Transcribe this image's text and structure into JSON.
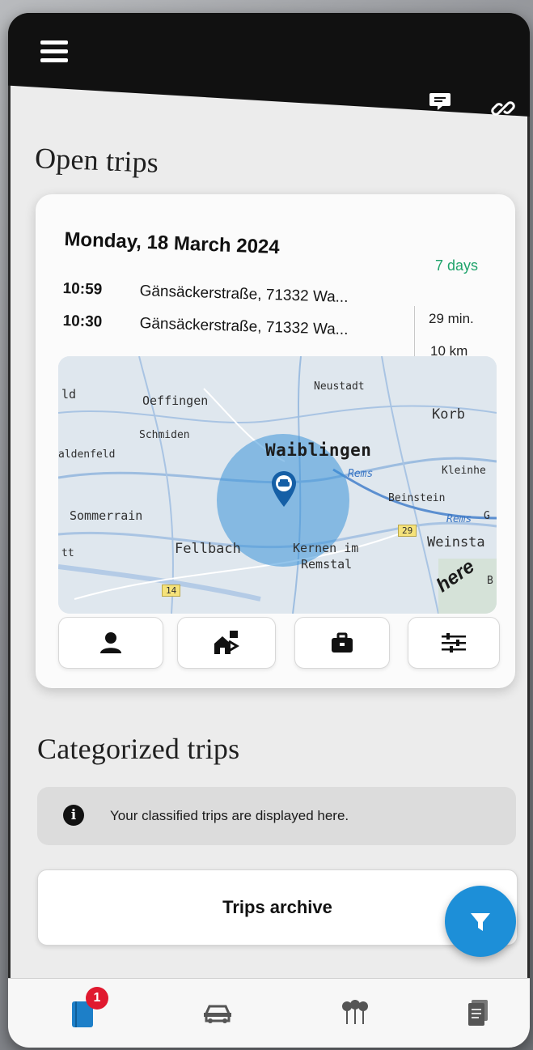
{
  "header": {
    "menu_icon": "hamburger-menu-icon",
    "actions": [
      "chat-icon",
      "link-icon"
    ]
  },
  "open_trips": {
    "title": "Open trips",
    "card": {
      "date": "Monday, 18 March 2024",
      "days_left": "7 days",
      "trips": [
        {
          "time": "10:59",
          "address": "Gänsäckerstraße, 71332 Wa..."
        },
        {
          "time": "10:30",
          "address": "Gänsäckerstraße, 71332 Wa..."
        }
      ],
      "duration": "29 min.",
      "distance": "10 km",
      "map": {
        "labels": {
          "ld": "ld",
          "oeffingen": "Oeffingen",
          "neustadt": "Neustadt",
          "korb": "Korb",
          "schmiden": "Schmiden",
          "waiblingen": "Waiblingen",
          "haldenfeld": "aldenfeld",
          "kleinheppach": "Kleinhe",
          "rems1": "Rems",
          "beinstein": "Beinstein",
          "sommerrain": "Sommerrain",
          "rems2": "Rems",
          "gr": "G",
          "road29": "29",
          "fellbach": "Fellbach",
          "kernen1": "Kernen im",
          "kernen2": "Remstal",
          "weinstadt": "Weinsta",
          "tt": "tt",
          "road14": "14",
          "b": "B",
          "attribution": "here"
        },
        "marker_icon": "car-location-pin-icon"
      },
      "category_buttons": [
        "person-icon",
        "house-commute-icon",
        "briefcase-icon",
        "sliders-icon"
      ]
    }
  },
  "categorized_trips": {
    "title": "Categorized trips",
    "info_text": "Your classified trips are displayed here."
  },
  "archive_button": "Trips archive",
  "fab_icon": "filter-icon",
  "bottom_nav": {
    "items": [
      "logbook-icon",
      "car-icon",
      "places-icon",
      "documents-icon"
    ],
    "badge": "1"
  },
  "colors": {
    "accent": "#1d8fd8",
    "days_green": "#1fa36b",
    "badge_red": "#e0192f",
    "header_black": "#111111"
  }
}
